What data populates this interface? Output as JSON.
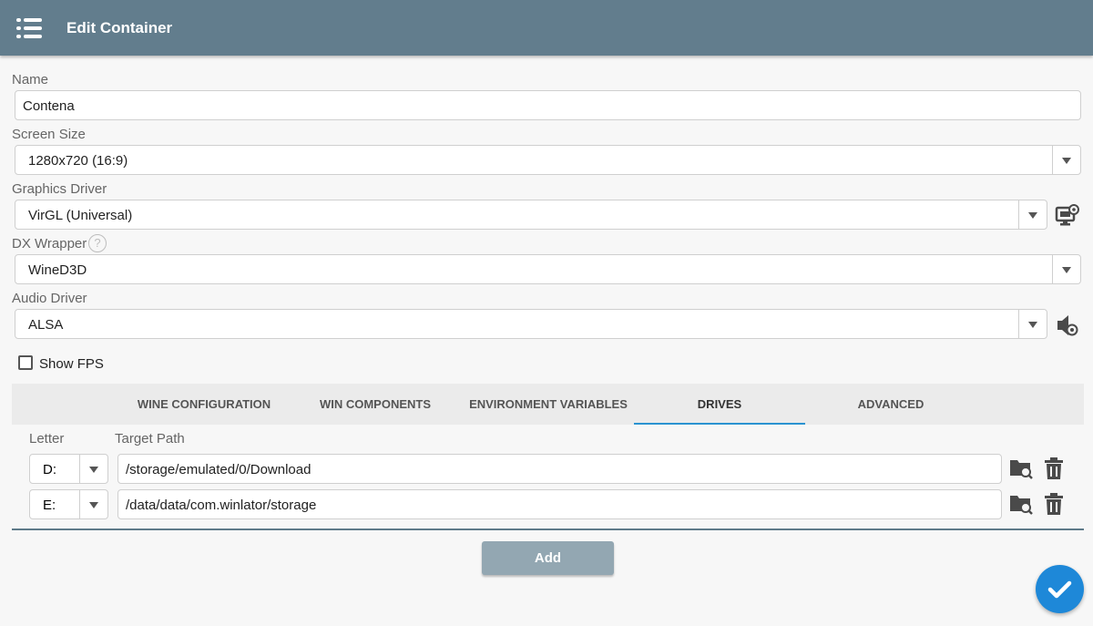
{
  "header": {
    "title": "Edit Container",
    "menu_icon": "menu-icon"
  },
  "form": {
    "name": {
      "label": "Name",
      "value": "Contena"
    },
    "screen_size": {
      "label": "Screen Size",
      "value": "1280x720 (16:9)"
    },
    "graphics_driver": {
      "label": "Graphics Driver",
      "value": "VirGL (Universal)",
      "settings_icon": "monitor-settings-icon"
    },
    "dx_wrapper": {
      "label": "DX Wrapper",
      "help_icon": "help-icon",
      "value": "WineD3D"
    },
    "audio_driver": {
      "label": "Audio Driver",
      "value": "ALSA",
      "settings_icon": "speaker-settings-icon"
    },
    "show_fps": {
      "label": "Show FPS",
      "checked": false
    }
  },
  "tabs": [
    {
      "label": "WINE CONFIGURATION",
      "active": false
    },
    {
      "label": "WIN COMPONENTS",
      "active": false
    },
    {
      "label": "ENVIRONMENT VARIABLES",
      "active": false
    },
    {
      "label": "DRIVES",
      "active": true
    },
    {
      "label": "ADVANCED",
      "active": false
    }
  ],
  "drives": {
    "columns": {
      "letter": "Letter",
      "target_path": "Target Path"
    },
    "rows": [
      {
        "letter": "D:",
        "path": "/storage/emulated/0/Download"
      },
      {
        "letter": "E:",
        "path": "/data/data/com.winlator/storage"
      }
    ],
    "add_label": "Add"
  },
  "colors": {
    "header": "#627d8d",
    "accent": "#2b93d1",
    "fab": "#1e88d8",
    "add_button": "#93a7b2"
  }
}
